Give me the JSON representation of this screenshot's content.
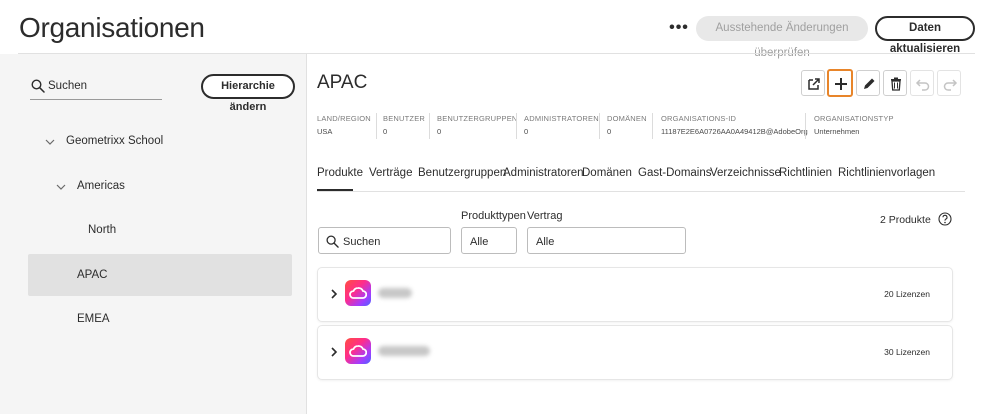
{
  "header": {
    "title": "Organisationen",
    "more_label": "•••",
    "review_label": "Ausstehende Änderungen überprüfen",
    "refresh_label": "Daten aktualisieren"
  },
  "sidebar": {
    "search_label": "Suchen",
    "hierarchy_button": "Hierarchie ändern",
    "tree": [
      {
        "label": "Geometrixx School"
      },
      {
        "label": "Americas"
      },
      {
        "label": "North"
      },
      {
        "label": "APAC",
        "selected": true
      },
      {
        "label": "EMEA"
      }
    ]
  },
  "org": {
    "title": "APAC",
    "meta": [
      {
        "head": "LAND/REGION",
        "value": "USA"
      },
      {
        "head": "BENUTZER",
        "value": "0"
      },
      {
        "head": "BENUTZERGRUPPEN",
        "value": "0"
      },
      {
        "head": "ADMINISTRATOREN",
        "value": "0"
      },
      {
        "head": "DOMÄNEN",
        "value": "0"
      },
      {
        "head": "ORGANISATIONS-ID",
        "value": "11187E2E6A0726AA0A49412B@AdobeOrg"
      },
      {
        "head": "ORGANISATIONSTYP",
        "value": "Unternehmen"
      }
    ]
  },
  "tabs": [
    {
      "label": "Produkte",
      "active": true
    },
    {
      "label": "Verträge"
    },
    {
      "label": "Benutzergruppen"
    },
    {
      "label": "Administratoren"
    },
    {
      "label": "Domänen"
    },
    {
      "label": "Gast-Domains"
    },
    {
      "label": "Verzeichnisse"
    },
    {
      "label": "Richtlinien"
    },
    {
      "label": "Richtlinienvorlagen"
    }
  ],
  "filters": {
    "search_label": "Suchen",
    "product_type_label": "Produkttypen",
    "product_type_value": "Alle",
    "contract_label": "Vertrag",
    "contract_value": "Alle",
    "count_label": "2 Produkte"
  },
  "products": [
    {
      "licenses": "20 Lizenzen"
    },
    {
      "licenses": "30 Lizenzen"
    }
  ],
  "colors": {
    "highlight": "#e8852a",
    "selected_row": "#e1e1e1",
    "panel_bg": "#f5f5f5"
  }
}
